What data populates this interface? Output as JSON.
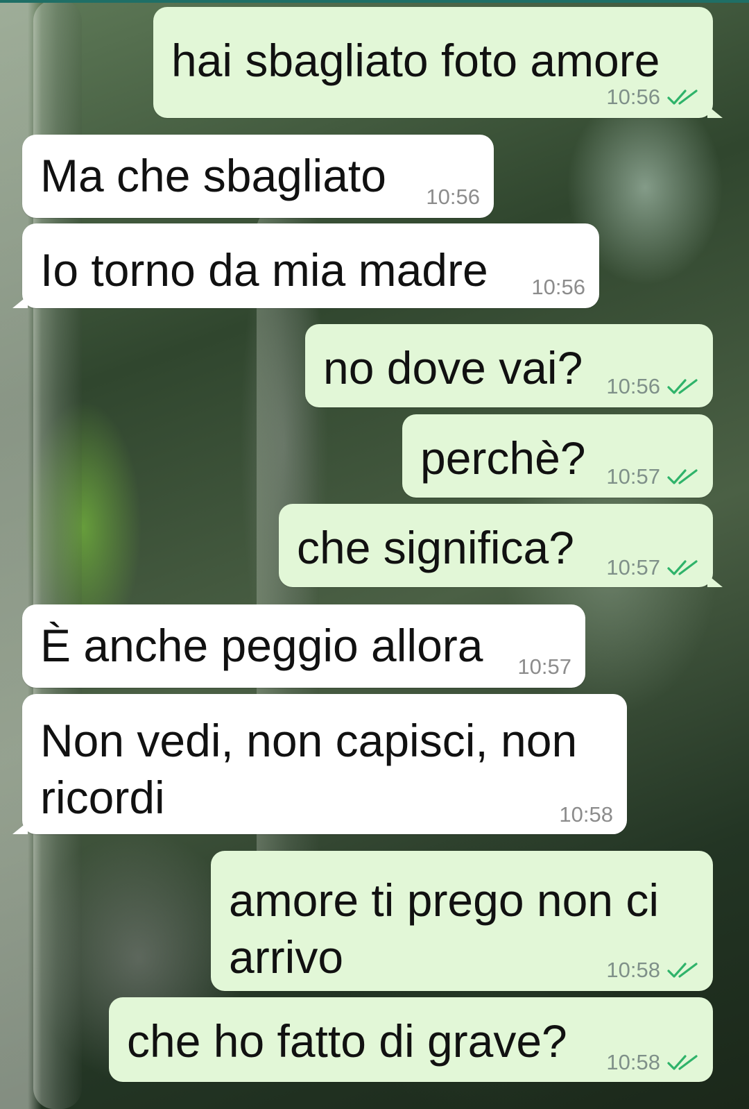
{
  "messages": [
    {
      "direction": "out",
      "text": "hai sbagliato foto amore",
      "time": "10:56",
      "status_icon": "double-check-icon"
    },
    {
      "direction": "in",
      "text": "Ma che sbagliato",
      "time": "10:56"
    },
    {
      "direction": "in",
      "text": "Io torno da mia madre",
      "time": "10:56"
    },
    {
      "direction": "out",
      "text": "no dove vai?",
      "time": "10:56",
      "status_icon": "double-check-icon"
    },
    {
      "direction": "out",
      "text": "perchè?",
      "time": "10:57",
      "status_icon": "double-check-icon"
    },
    {
      "direction": "out",
      "text": "che significa?",
      "time": "10:57",
      "status_icon": "double-check-icon"
    },
    {
      "direction": "in",
      "text": "È anche peggio allora",
      "time": "10:57"
    },
    {
      "direction": "in",
      "text": "Non vedi, non capisci, non\nricordi",
      "time": "10:58"
    },
    {
      "direction": "out",
      "text": "amore ti prego non ci\narrivo",
      "time": "10:58",
      "status_icon": "double-check-icon"
    },
    {
      "direction": "out",
      "text": "che ho fatto di grave?",
      "time": "10:58",
      "status_icon": "double-check-icon"
    }
  ],
  "colors": {
    "outgoing_bubble": "#e2f7d7",
    "incoming_bubble": "#ffffff",
    "read_ticks": "#2fb36a",
    "timestamp": "#7f9089"
  }
}
